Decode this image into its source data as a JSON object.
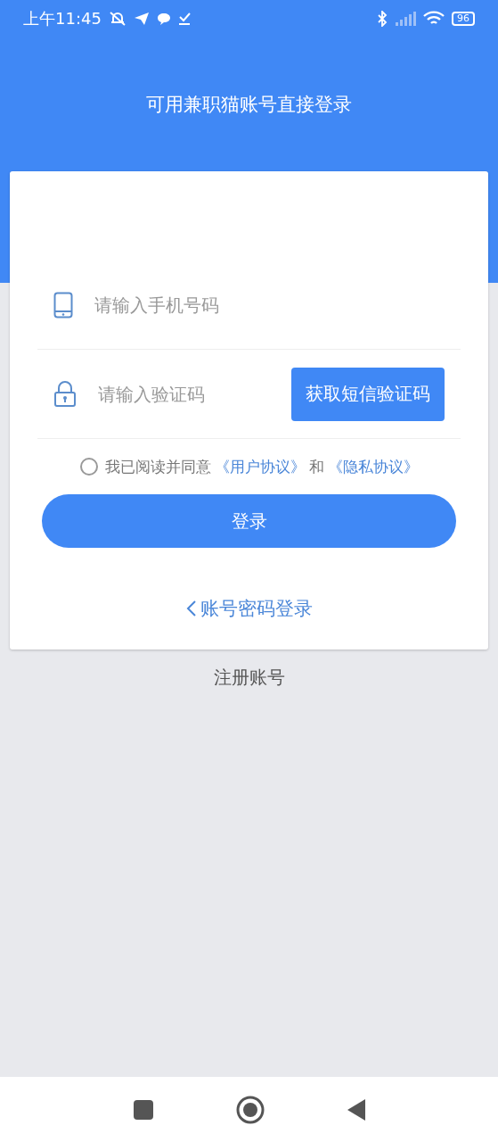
{
  "status_bar": {
    "time": "上午11:45",
    "battery": "96"
  },
  "header": {
    "title": "可用兼职猫账号直接登录"
  },
  "form": {
    "phone": {
      "placeholder": "请输入手机号码"
    },
    "code": {
      "placeholder": "请输入验证码"
    },
    "get_code_button": "获取短信验证码",
    "agreement": {
      "checked": false,
      "text": "我已阅读并同意",
      "user_link": "《用户协议》",
      "and": "和",
      "privacy_link": "《隐私协议》"
    },
    "login_button": "登录",
    "password_login_link": "账号密码登录"
  },
  "register_link": "注册账号"
}
